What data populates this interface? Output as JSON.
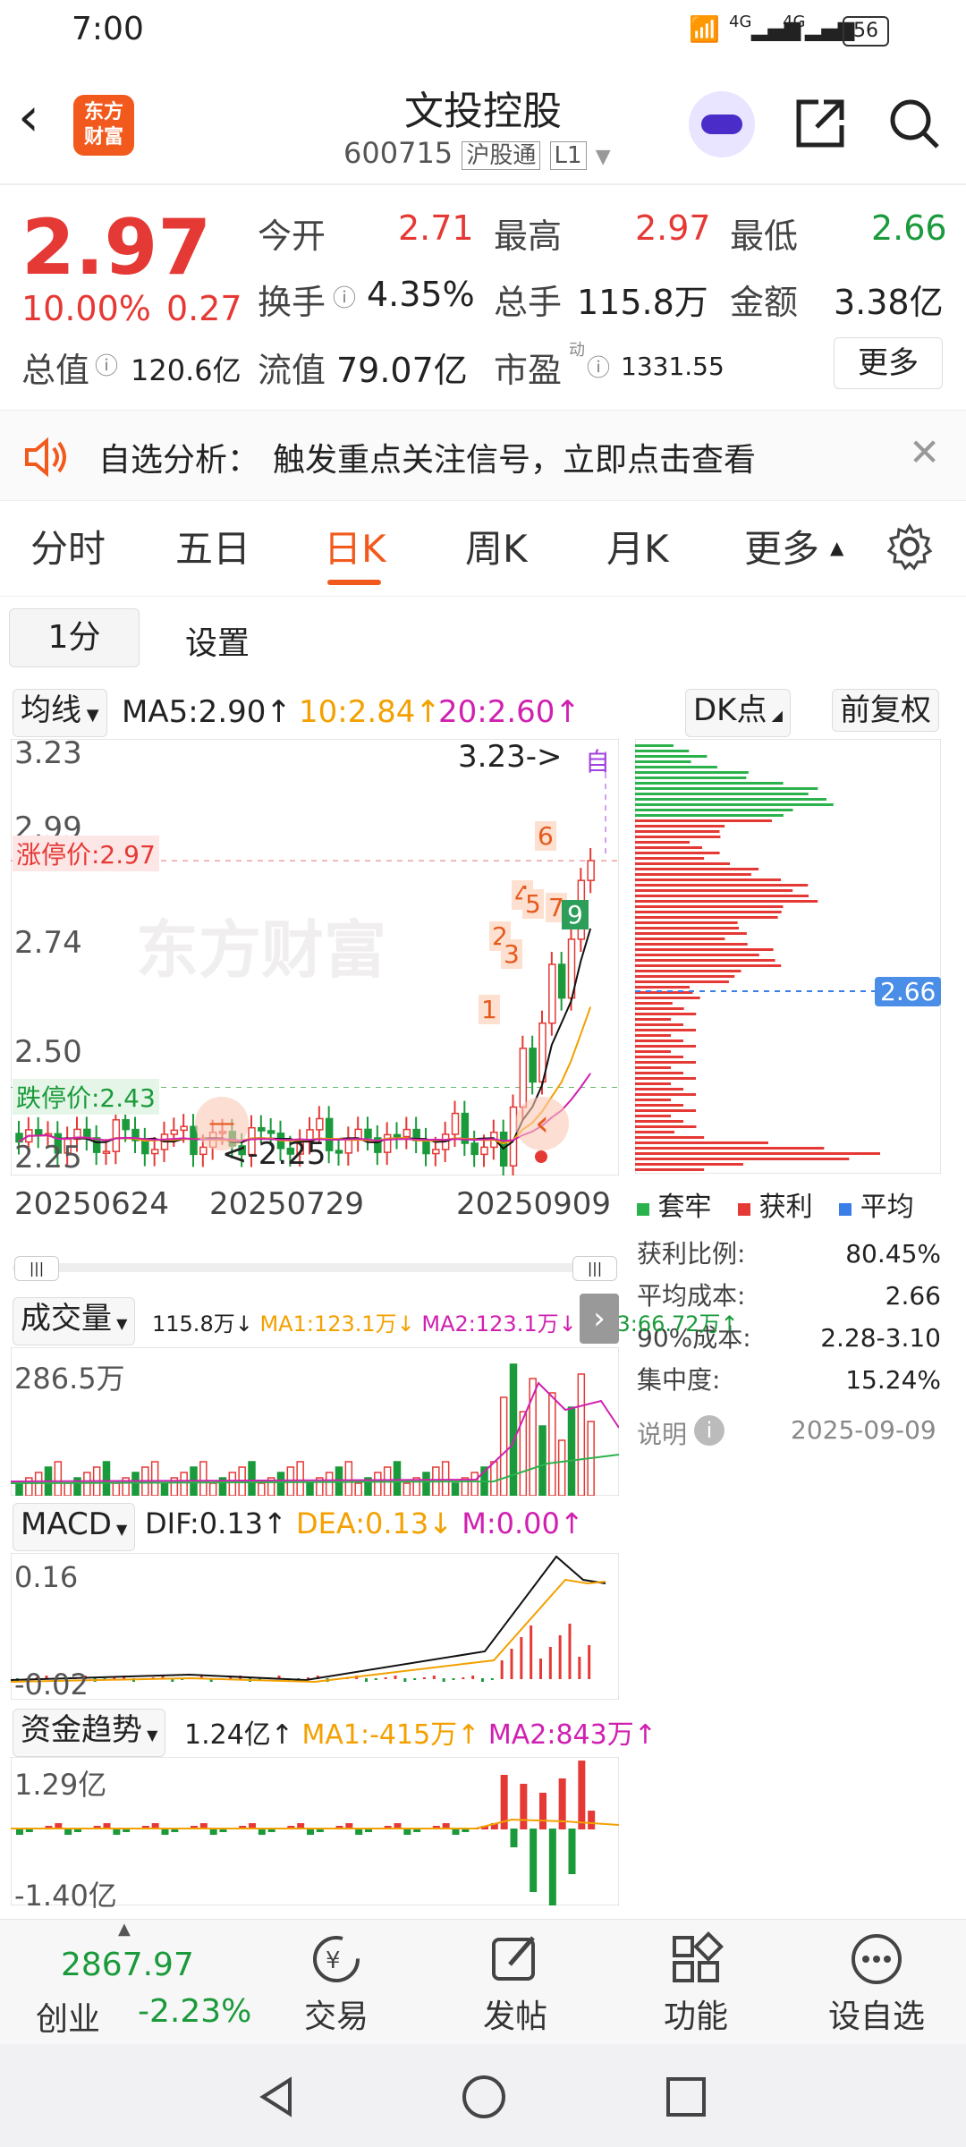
{
  "status": {
    "time": "7:00",
    "battery": "56",
    "net1": "4G",
    "net2": "4G"
  },
  "header": {
    "logo_line1": "东方",
    "logo_line2": "财富",
    "title": "文投控股",
    "code": "600715",
    "tag1": "沪股通",
    "tag2": "L1"
  },
  "quote": {
    "price": "2.97",
    "pct": "10.00%",
    "chg": "0.27",
    "open_label": "今开",
    "open": "2.71",
    "high_label": "最高",
    "high": "2.97",
    "low_label": "最低",
    "low": "2.66",
    "turnover_label": "换手",
    "turnover": "4.35%",
    "vol_label": "总手",
    "vol": "115.8万",
    "amt_label": "金额",
    "amt": "3.38亿",
    "mcap_label": "总值",
    "mcap": "120.6亿",
    "float_label": "流值",
    "float": "79.07亿",
    "pe_label": "市盈",
    "pe_sup": "动",
    "pe": "1331.55",
    "more": "更多"
  },
  "banner": {
    "label": "自选分析：",
    "text": "触发重点关注信号，立即点击查看"
  },
  "tabs": [
    "分时",
    "五日",
    "日K",
    "周K",
    "月K",
    "更多"
  ],
  "subtabs": {
    "interval": "1分",
    "settings": "设置"
  },
  "kline": {
    "indicator": "均线",
    "ma5": "MA5:2.90↑",
    "ma10": "10:2.84↑",
    "ma20": "20:2.60↑",
    "dk": "DK点",
    "adj": "前复权",
    "y_labels": [
      "3.23",
      "2.99",
      "2.74",
      "2.50",
      "2.25"
    ],
    "limit_up": "涨停价:2.97",
    "limit_down": "跌停价:2.43",
    "max_label": "3.23->",
    "min_label": "<-2.25",
    "self_mark": "自",
    "dates": [
      "20250624",
      "20250729",
      "20250909"
    ],
    "signals": [
      "1",
      "2",
      "3",
      "4",
      "5",
      "6",
      "7",
      "9"
    ],
    "nav_left": "—",
    "nav_right": "‹"
  },
  "chips": {
    "cost_marker": "2.66",
    "legend": [
      "套牢",
      "获利",
      "平均"
    ],
    "rows": [
      {
        "label": "获利比例:",
        "value": "80.45%"
      },
      {
        "label": "平均成本:",
        "value": "2.66"
      },
      {
        "label": "90%成本:",
        "value": "2.28-3.10"
      },
      {
        "label": "集中度:",
        "value": "15.24%"
      }
    ],
    "note": "说明",
    "date": "2025-09-09"
  },
  "volume": {
    "name": "成交量",
    "val": "115.8万↓",
    "ma1": "MA1:123.1万↓",
    "ma2": "MA2:123.1万↓",
    "ma3": "MA3:66.72万↑",
    "ymax": "286.5万"
  },
  "macd": {
    "name": "MACD",
    "dif": "DIF:0.13↑",
    "dea": "DEA:0.13↓",
    "m": "M:0.00↑",
    "ymax": "0.16",
    "ymin": "-0.02"
  },
  "fund": {
    "name": "资金趋势",
    "val": "1.24亿↑",
    "ma1": "MA1:-415万↑",
    "ma2": "MA2:843万↑",
    "ymax": "1.29亿",
    "ymin": "-1.40亿"
  },
  "bottom": {
    "index_val": "2867.97",
    "index_name": "创业",
    "index_pct": "-2.23%",
    "items": [
      "交易",
      "发帖",
      "功能",
      "设自选"
    ]
  },
  "colors": {
    "up": "#e53935",
    "down": "#1a9a3a",
    "accent": "#f25a1d"
  }
}
